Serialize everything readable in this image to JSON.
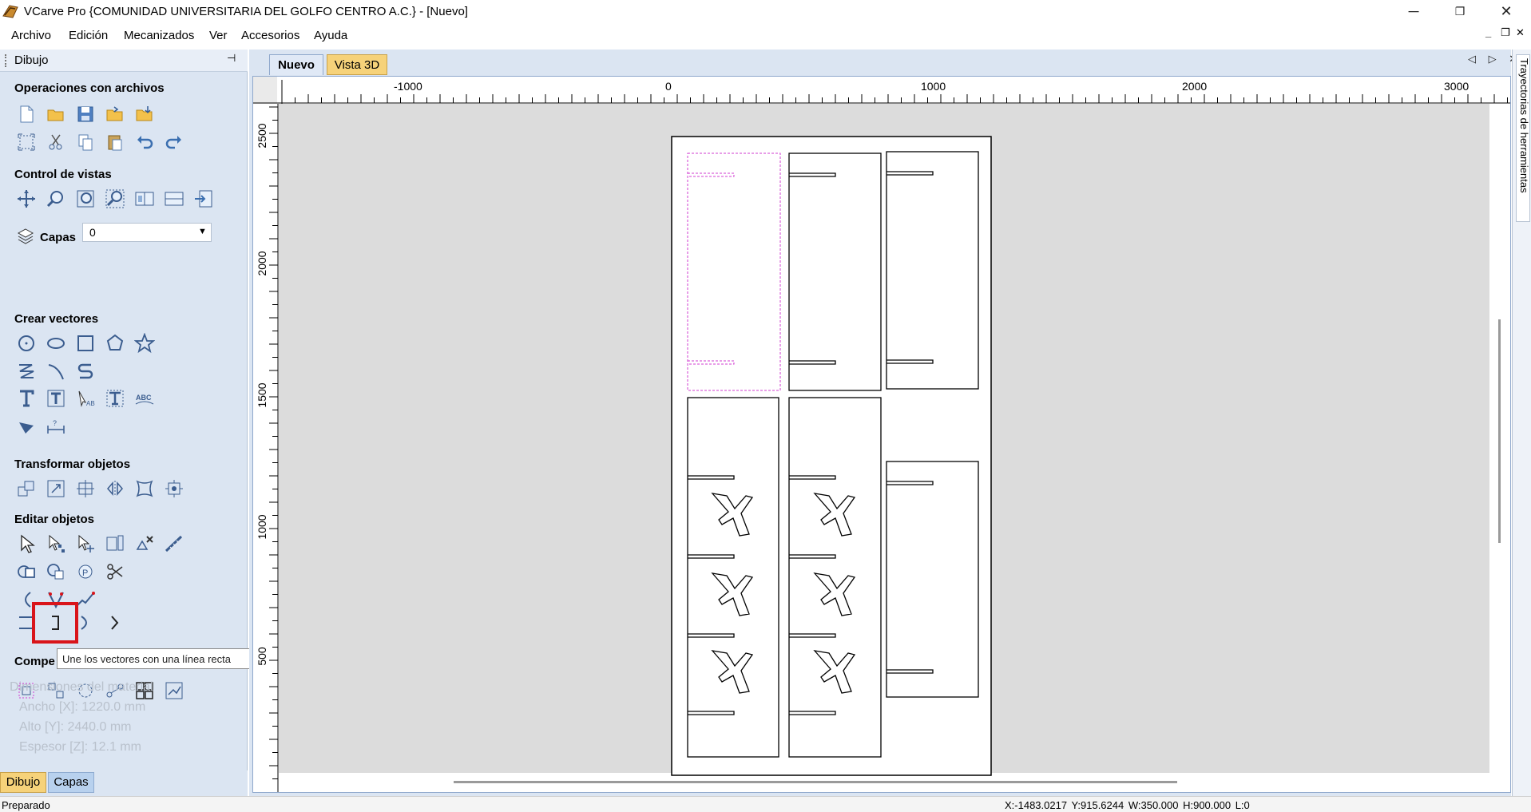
{
  "window": {
    "title": "VCarve Pro {COMUNIDAD UNIVERSITARIA DEL GOLFO CENTRO  A.C.} - [Nuevo]",
    "minimize": "─",
    "restore": "❐",
    "close": "✕",
    "app_icon": "vcarve-app-icon"
  },
  "menu": {
    "items": [
      "Archivo",
      "Edición",
      "Mecanizados",
      "Ver",
      "Accesorios",
      "Ayuda"
    ],
    "mdi": {
      "minimize": "_",
      "restore": "❐",
      "close": "✕"
    }
  },
  "left_panel": {
    "title": "Dibujo",
    "pin": "⊣",
    "sections": {
      "file_ops": "Operaciones con archivos",
      "view_control": "Control de vistas",
      "create_vectors": "Crear vectores",
      "transform": "Transformar objetos",
      "edit": "Editar objetos",
      "compensation": "Compe"
    },
    "layers": {
      "label": "Capas",
      "value": "0"
    },
    "tooltip": "Une los vectores con una línea recta",
    "ghost_lines": [
      "Dimensiones del material",
      "Ancho   [X]: 1220.0 mm",
      "Alto    [Y]: 2440.0 mm",
      "Espesor [Z]: 12.1 mm"
    ],
    "bottom_tabs": [
      "Dibujo",
      "Capas"
    ]
  },
  "document": {
    "tabs": [
      "Nuevo",
      "Vista 3D"
    ],
    "nav_icons": "◁ ▷ ✕",
    "hruler_labels": [
      "-1000",
      "0",
      "1000",
      "2000",
      "3000"
    ],
    "vruler_labels": [
      "2500",
      "2000",
      "1500",
      "1000",
      "500"
    ]
  },
  "right_strip": {
    "label": "Trayectorias de herramientas"
  },
  "status": {
    "left": "Preparado",
    "right": "X:-1483.0217 Y:915.6244   W:350.000   H:900.000  L:0"
  },
  "colors": {
    "panel": "#dbe5f2",
    "selection_highlight": "#d9141a",
    "dashed_selection": "#d23ed2",
    "tab_active": "#f6d27a"
  }
}
